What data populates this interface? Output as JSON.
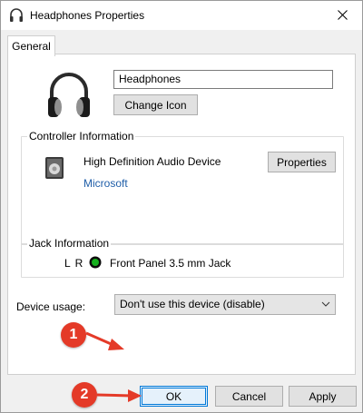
{
  "window": {
    "title": "Headphones Properties",
    "close_glyph": "✕"
  },
  "tabs": [
    {
      "label": "General"
    }
  ],
  "device": {
    "name_value": "Headphones",
    "change_icon_label": "Change Icon"
  },
  "controller": {
    "group_label": "Controller Information",
    "device_name": "High Definition Audio Device",
    "manufacturer": "Microsoft",
    "properties_label": "Properties"
  },
  "jack": {
    "group_label": "Jack Information",
    "channels": "L R",
    "description": "Front Panel 3.5 mm Jack",
    "dot_color": "#17b11f"
  },
  "usage": {
    "label": "Device usage:",
    "selected_option": "Don't use this device (disable)"
  },
  "footer": {
    "ok_label": "OK",
    "cancel_label": "Cancel",
    "apply_label": "Apply"
  },
  "annotations": {
    "badge_1": "1",
    "badge_2": "2",
    "badge_color": "#e43a28"
  }
}
